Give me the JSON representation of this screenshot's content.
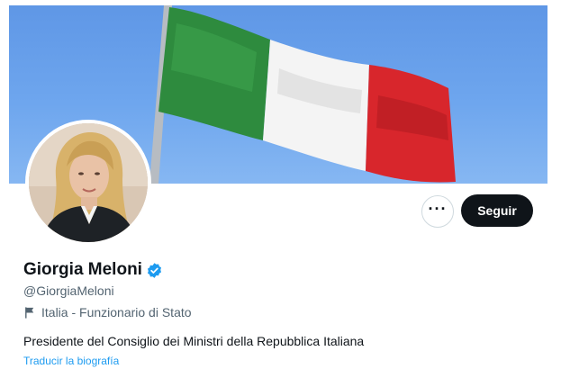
{
  "profile": {
    "name": "Giorgia Meloni",
    "handle": "@GiorgiaMeloni",
    "location_category": "Italia - Funzionario di Stato",
    "bio": "Presidente del Consiglio dei Ministri della Repubblica Italiana",
    "translate_bio": "Traducir la biografía",
    "verified": true
  },
  "actions": {
    "follow_label": "Seguir",
    "more_icon": "more-dots-icon"
  },
  "colors": {
    "accent": "#1d9bf0",
    "follow_bg": "#0f1419",
    "flag_green": "#2e8b3e",
    "flag_white": "#f4f4f4",
    "flag_red": "#d8262c",
    "sky": "#6ea6ee"
  },
  "icons": {
    "verified": "verified-badge-icon",
    "category": "flag-icon"
  }
}
